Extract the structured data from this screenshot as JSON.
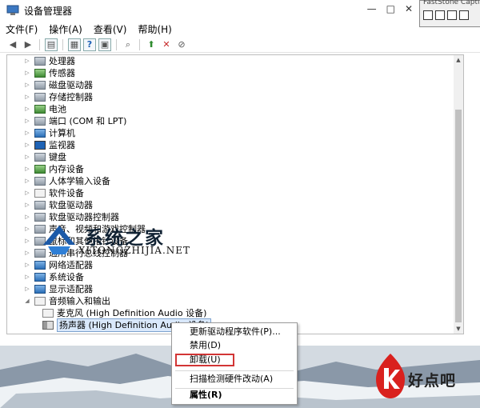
{
  "window": {
    "title": "设备管理器",
    "controls": [
      "—",
      "□",
      "✕"
    ]
  },
  "snip_toolbar": {
    "title": "FastStone Capture"
  },
  "menu": [
    "文件(F)",
    "操作(A)",
    "查看(V)",
    "帮助(H)"
  ],
  "toolbar_icons": [
    "back-icon",
    "forward-icon",
    "properties-icon",
    "show-hidden-icon",
    "help-icon",
    "view-icon",
    "scan-icon",
    "update-driver-icon",
    "uninstall-icon",
    "disable-icon"
  ],
  "tree": {
    "items": [
      {
        "label": "处理器",
        "icon": "cpu-icon",
        "expander": "▷"
      },
      {
        "label": "传感器",
        "icon": "sensor-icon",
        "expander": "▷"
      },
      {
        "label": "磁盘驱动器",
        "icon": "disk-icon",
        "expander": "▷"
      },
      {
        "label": "存储控制器",
        "icon": "storage-controller-icon",
        "expander": "▷"
      },
      {
        "label": "电池",
        "icon": "battery-icon",
        "expander": "▷"
      },
      {
        "label": "端口 (COM 和 LPT)",
        "icon": "port-icon",
        "expander": "▷"
      },
      {
        "label": "计算机",
        "icon": "computer-icon",
        "expander": "▷"
      },
      {
        "label": "监视器",
        "icon": "monitor-icon",
        "expander": "▷"
      },
      {
        "label": "键盘",
        "icon": "keyboard-icon",
        "expander": "▷"
      },
      {
        "label": "内存设备",
        "icon": "memory-icon",
        "expander": "▷"
      },
      {
        "label": "人体学输入设备",
        "icon": "hid-icon",
        "expander": "▷"
      },
      {
        "label": "软件设备",
        "icon": "software-device-icon",
        "expander": "▷"
      },
      {
        "label": "软盘驱动器",
        "icon": "floppy-icon",
        "expander": "▷"
      },
      {
        "label": "软盘驱动器控制器",
        "icon": "floppy-controller-icon",
        "expander": "▷"
      },
      {
        "label": "声音、视频和游戏控制器",
        "icon": "sound-icon",
        "expander": "▷"
      },
      {
        "label": "鼠标和其他指针设备",
        "icon": "mouse-icon",
        "expander": "▷"
      },
      {
        "label": "通用串行总线控制器",
        "icon": "usb-icon",
        "expander": "▷"
      },
      {
        "label": "网络适配器",
        "icon": "network-icon",
        "expander": "▷"
      },
      {
        "label": "系统设备",
        "icon": "system-device-icon",
        "expander": "▷"
      },
      {
        "label": "显示适配器",
        "icon": "display-adapter-icon",
        "expander": "▷"
      },
      {
        "label": "音频输入和输出",
        "icon": "audio-io-icon",
        "expander": "◢"
      }
    ],
    "children": [
      {
        "label": "麦克风 (High Definition Audio 设备)",
        "icon": "microphone-icon"
      },
      {
        "label": "扬声器 (High Definition Audio 设备)",
        "icon": "speaker-icon",
        "selected": true
      }
    ]
  },
  "context_menu": {
    "items": [
      "更新驱动程序软件(P)...",
      "禁用(D)",
      "卸载(U)",
      "扫描检测硬件改动(A)",
      "属性(R)"
    ],
    "highlighted": "卸载(U)",
    "highlight_color": "#d23535"
  },
  "watermark": {
    "text": "系统之家",
    "url": "XITONGZHIJIA.NET"
  },
  "brand": {
    "text": "好点吧",
    "color": "#d9211e"
  }
}
